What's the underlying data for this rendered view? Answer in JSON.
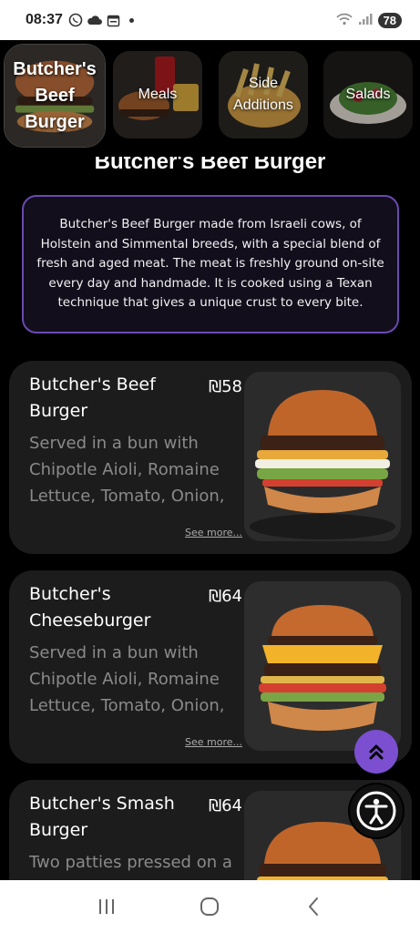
{
  "status_bar": {
    "time": "08:37",
    "battery": "78",
    "icons": [
      "whatsapp-icon",
      "cloud-icon",
      "calendar-icon",
      "dot-icon",
      "wifi-icon",
      "signal-icon"
    ]
  },
  "categories": [
    {
      "label": "Butcher's Beef Burger",
      "active": true
    },
    {
      "label": "Meals",
      "active": false
    },
    {
      "label": "Side Additions",
      "active": false
    },
    {
      "label": "Salads",
      "active": false
    }
  ],
  "section": {
    "title": "Butcher's Beef Burger",
    "description": "Butcher's Beef Burger made from Israeli cows, of Holstein and Simmental breeds, with a special blend of fresh and aged meat. The meat is freshly ground on-site every day and handmade. It is cooked using a Texan technique that gives a unique crust to every bite."
  },
  "menu_items": [
    {
      "name": "Butcher's Beef Burger",
      "price": "₪58",
      "description": "Served in a bun with Chipotle Aioli, Romaine Lettuce, Tomato, Onion, ...",
      "see_more": "See more..."
    },
    {
      "name": "Butcher's Cheeseburger",
      "price": "₪64",
      "description": "Served in a bun with Chipotle Aioli, Romaine Lettuce, Tomato, Onion, ...",
      "see_more": "See more..."
    },
    {
      "name": "Butcher's Smash Burger",
      "price": "₪64",
      "description": "Two patties pressed on a",
      "see_more": ""
    }
  ],
  "colors": {
    "accent": "#7b4fd0",
    "description_border": "#6a4ab0",
    "card_bg": "#1c1c1c",
    "muted_text": "#8a8a8a"
  },
  "floating": {
    "scroll_top_icon": "double-chevron-up-icon",
    "accessibility_icon": "accessibility-icon"
  },
  "nav_bar": {
    "buttons": [
      "recent-apps-icon",
      "home-icon",
      "back-icon"
    ]
  }
}
